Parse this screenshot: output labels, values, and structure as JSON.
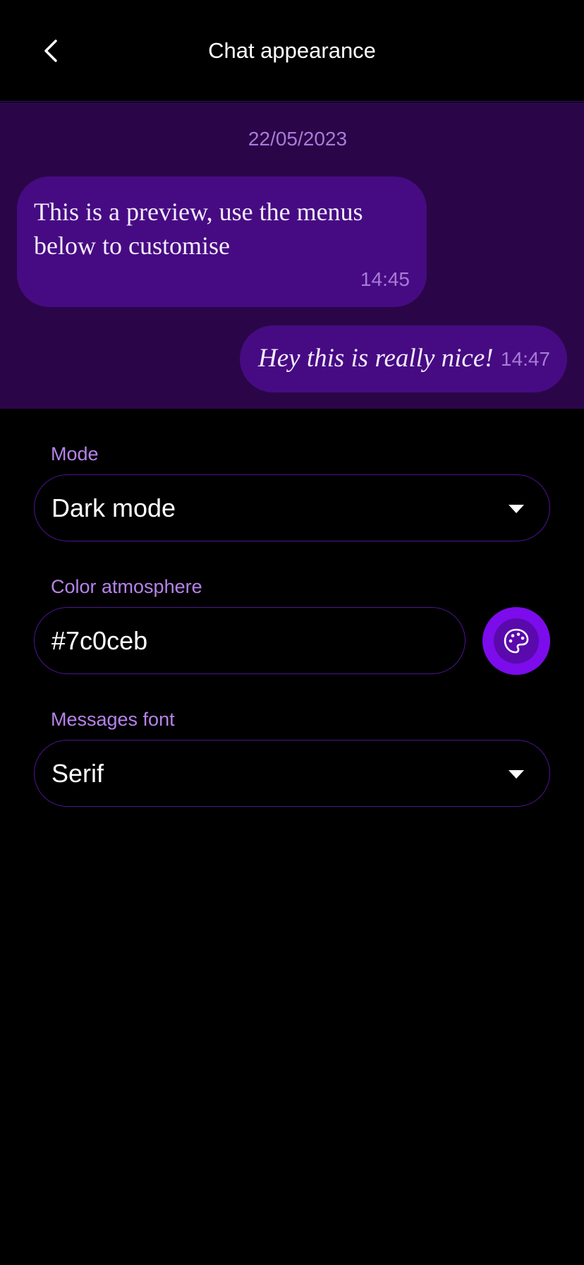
{
  "header": {
    "title": "Chat appearance",
    "back_icon": "chevron-left-icon"
  },
  "preview": {
    "date": "22/05/2023",
    "incoming": {
      "text": "This is a preview, use the menus below to customise",
      "time": "14:45"
    },
    "outgoing": {
      "text": "Hey this is really nice!",
      "time": "14:47"
    }
  },
  "settings": {
    "mode": {
      "label": "Mode",
      "value": "Dark mode"
    },
    "color": {
      "label": "Color atmosphere",
      "value": "#7c0ceb",
      "picker_icon": "palette-icon"
    },
    "font": {
      "label": "Messages font",
      "value": "Serif"
    }
  },
  "colors": {
    "background": "#000000",
    "preview_background": "#2a0648",
    "bubble": "#460b82",
    "accent": "#7c0ceb",
    "label": "#b583ea",
    "border": "#4e1494"
  }
}
